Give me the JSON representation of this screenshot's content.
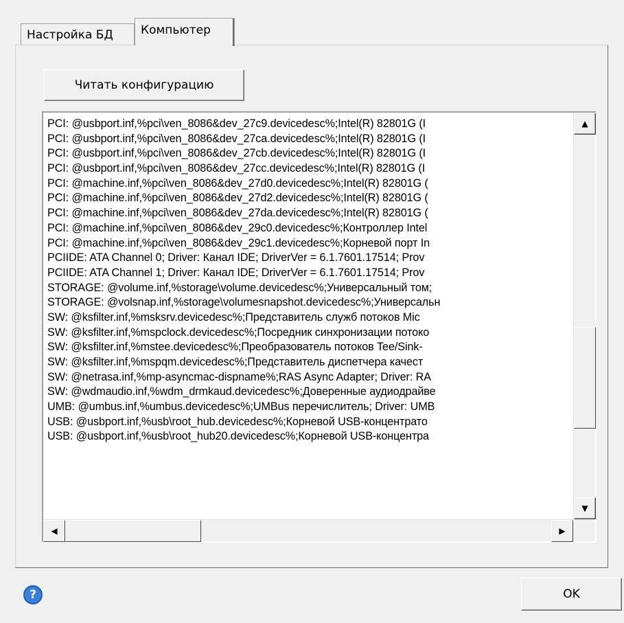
{
  "tabs": [
    {
      "label": "Настройка БД"
    },
    {
      "label": "Компьютер"
    }
  ],
  "read_button": {
    "label": "Читать конфигурацию"
  },
  "list": {
    "lines": [
      "PCI: @usbport.inf,%pci\\ven_8086&dev_27c9.devicedesc%;Intel(R) 82801G (I",
      "PCI: @usbport.inf,%pci\\ven_8086&dev_27ca.devicedesc%;Intel(R) 82801G (I",
      "PCI: @usbport.inf,%pci\\ven_8086&dev_27cb.devicedesc%;Intel(R) 82801G (I",
      "PCI: @usbport.inf,%pci\\ven_8086&dev_27cc.devicedesc%;Intel(R) 82801G (I",
      "PCI: @machine.inf,%pci\\ven_8086&dev_27d0.devicedesc%;Intel(R) 82801G (",
      "PCI: @machine.inf,%pci\\ven_8086&dev_27d2.devicedesc%;Intel(R) 82801G (",
      "PCI: @machine.inf,%pci\\ven_8086&dev_27da.devicedesc%;Intel(R) 82801G (",
      "PCI: @machine.inf,%pci\\ven_8086&dev_29c0.devicedesc%;Контроллер Intel",
      "PCI: @machine.inf,%pci\\ven_8086&dev_29c1.devicedesc%;Корневой порт In",
      "PCIIDE: ATA Channel 0;  Driver: Канал IDE; DriverVer = 6.1.7601.17514; Prov",
      "PCIIDE: ATA Channel 1;  Driver: Канал IDE; DriverVer = 6.1.7601.17514; Prov",
      "STORAGE: @volume.inf,%storage\\volume.devicedesc%;Универсальный том;",
      "STORAGE: @volsnap.inf,%storage\\volumesnapshot.devicedesc%;Универсальн",
      "SW: @ksfilter.inf,%msksrv.devicedesc%;Представитель служб потоков Mic",
      "SW: @ksfilter.inf,%mspclock.devicedesc%;Посредник синхронизации потоко",
      "SW: @ksfilter.inf,%mstee.devicedesc%;Преобразователь потоков Tee/Sink-",
      "SW: @ksfilter.inf,%mspqm.devicedesc%;Представитель диспетчера качест",
      "SW: @netrasa.inf,%mp-asyncmac-dispname%;RAS Async Adapter;  Driver: RA",
      "SW: @wdmaudio.inf,%wdm_drmkaud.devicedesc%;Доверенные аудиодрайве",
      "UMB: @umbus.inf,%umbus.devicedesc%;UMBus перечислитель;  Driver: UMB",
      "USB: @usbport.inf,%usb\\root_hub.devicedesc%;Корневой USB-концентрато",
      "USB: @usbport.inf,%usb\\root_hub20.devicedesc%;Корневой USB-концентра"
    ]
  },
  "scroll": {
    "vertical_position": 0.55,
    "horizontal_position": 0.0
  },
  "icons": {
    "scroll_up": "▲",
    "scroll_down": "▼",
    "scroll_left": "◀",
    "scroll_right": "▶",
    "help": "?"
  },
  "help_button": {
    "icon": "help-icon",
    "glyph": "?"
  },
  "ok_button": {
    "label": "OK"
  }
}
